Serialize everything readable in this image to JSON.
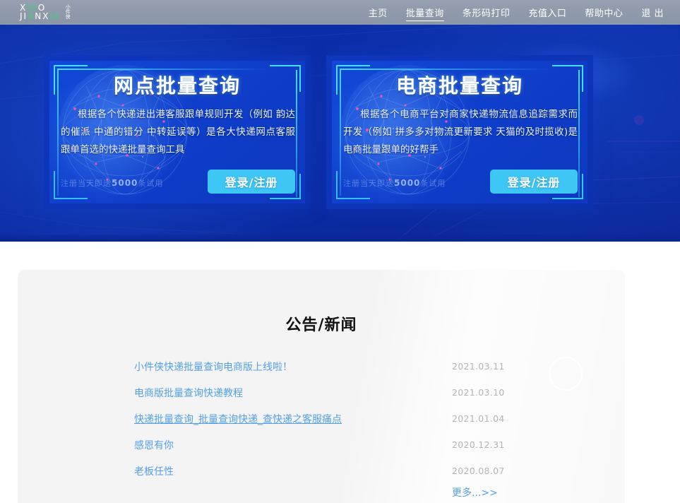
{
  "header": {
    "logo": {
      "line1": "XIVO",
      "line2": "JIANXIA",
      "cn": "小件侠"
    },
    "nav": [
      {
        "label": "主页",
        "active": false
      },
      {
        "label": "批量查询",
        "active": true
      },
      {
        "label": "条形码打印",
        "active": false
      },
      {
        "label": "充值入口",
        "active": false
      },
      {
        "label": "帮助中心",
        "active": false
      },
      {
        "label": "退 出",
        "active": false
      }
    ]
  },
  "hero": {
    "cards": [
      {
        "title": "网点批量查询",
        "desc": "根据各个快递进出港客服跟单规则开发（例如 韵达的催派 中通的错分 中转延误等）是各大快递网点客服跟单首选的快递批量查询工具",
        "note_prefix": "注册当天即送",
        "note_number": "5000",
        "note_suffix": "条试用",
        "button": "登录/注册"
      },
      {
        "title": "电商批量查询",
        "desc": "根据各个电商平台对商家快递物流信息追踪需求而开发（例如 拼多多对物流更新要求 天猫的及时揽收)是电商批量跟单的好帮手",
        "note_prefix": "注册当天即送",
        "note_number": "5000",
        "note_suffix": "条试用",
        "button": "登录/注册"
      }
    ]
  },
  "news": {
    "title": "公告/新闻",
    "items": [
      {
        "title": "小件侠快递批量查询电商版上线啦！",
        "date": "2021.03.11",
        "underlined": false
      },
      {
        "title": "电商版批量查询快递教程",
        "date": "2021.03.10",
        "underlined": false
      },
      {
        "title": "快递批量查询_批量查询快递_查快递之客服痛点",
        "date": "2021.01.04",
        "underlined": true
      },
      {
        "title": "感恩有你",
        "date": "2020.12.31",
        "underlined": false
      },
      {
        "title": "老板任性",
        "date": "2020.08.07",
        "underlined": false
      }
    ],
    "more_label": "更多...>>"
  },
  "colors": {
    "hero_blue": "#0b2ea8",
    "card_blue": "#0f3fcb",
    "accent_cyan": "#3fe0ff",
    "button_cyan": "#3ec7f5",
    "link_blue": "#54a0e8",
    "topbar_gray": "#8e99aa",
    "panel_gray": "#f4f4f4",
    "logo_green": "#3dd07a"
  }
}
